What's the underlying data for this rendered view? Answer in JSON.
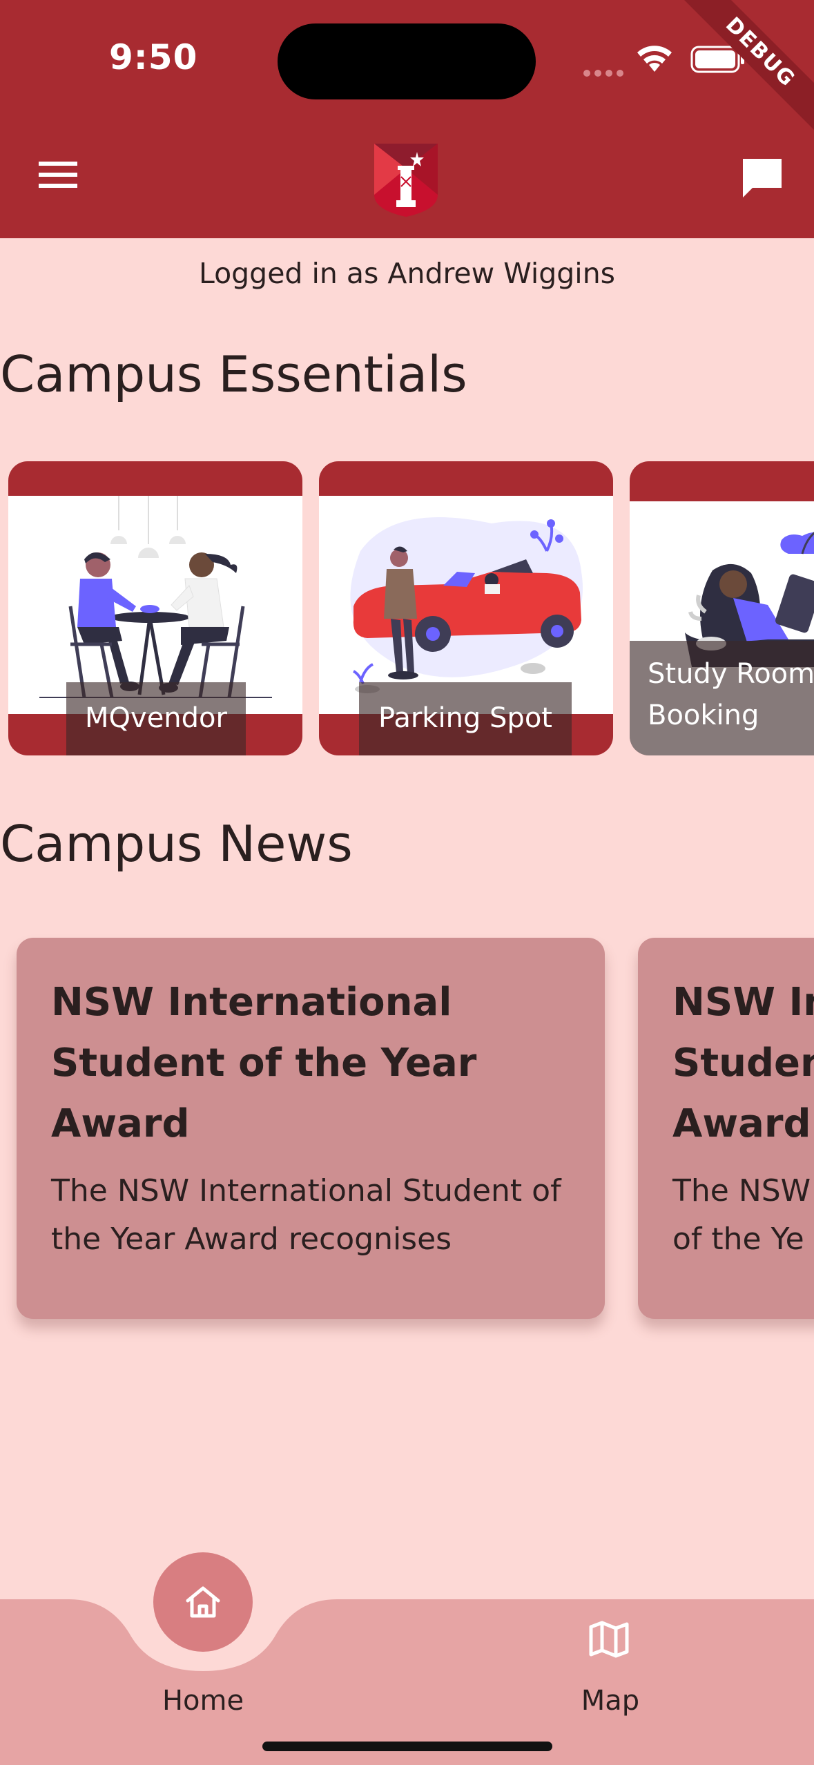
{
  "status_bar": {
    "time": "9:50",
    "debug_label": "DEBUG"
  },
  "header": {
    "menu_icon": "hamburger-menu-icon",
    "logo_icon": "university-crest-icon",
    "chat_icon": "chat-bubble-icon"
  },
  "logged_in_text": "Logged in as Andrew Wiggins",
  "essentials": {
    "title": "Campus Essentials",
    "cards": [
      {
        "label": "MQvendor",
        "icon": "dining-illustration"
      },
      {
        "label": "Parking Spot",
        "icon": "car-parking-illustration"
      },
      {
        "label_line1": "Study Room",
        "label_line2": "Booking",
        "icon": "study-illustration"
      }
    ]
  },
  "news": {
    "title": "Campus News",
    "items": [
      {
        "title": "NSW International Student of the Year Award",
        "body": "The NSW International Student of the Year Award recognises"
      },
      {
        "title_lines": [
          "NSW In",
          "Studen",
          "Award"
        ],
        "body_lines": [
          "The NSW",
          "of the Ye"
        ]
      }
    ]
  },
  "bottom_nav": {
    "items": [
      {
        "label": "Home",
        "icon": "home-icon",
        "active": true
      },
      {
        "label": "Map",
        "icon": "map-icon",
        "active": false
      }
    ]
  },
  "colors": {
    "primary": "#A82B31",
    "background": "#FDD9D6",
    "news_card": "#CD8F91",
    "nav_bar": "#E6A4A4",
    "nav_active_bubble": "#D87E81"
  }
}
